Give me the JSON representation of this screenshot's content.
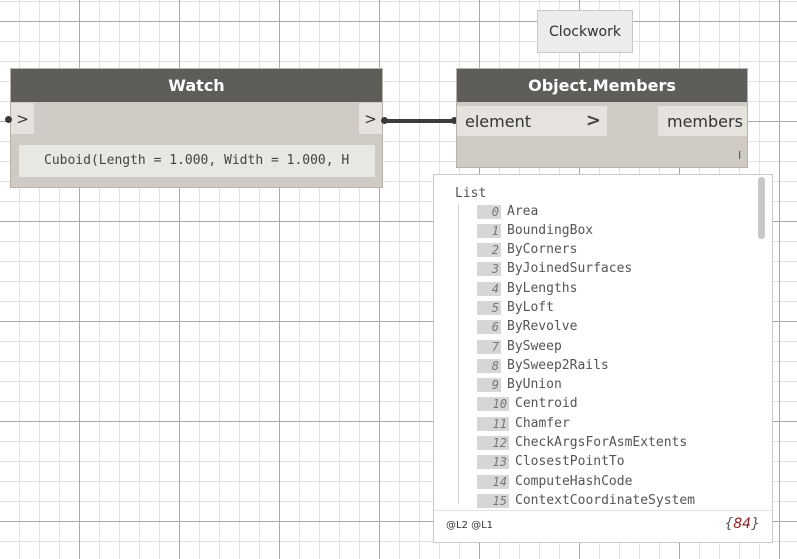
{
  "group_tag": {
    "label": "Clockwork"
  },
  "watch_node": {
    "title": "Watch",
    "input_port": ">",
    "output_port": ">",
    "value": "Cuboid(Length = 1.000, Width = 1.000, H"
  },
  "members_node": {
    "title": "Object.Members",
    "input_port": "element",
    "input_chevron": ">",
    "output_port": "members",
    "lacing": "I"
  },
  "preview": {
    "list_label": "List",
    "items": [
      {
        "index": "0",
        "value": "Area"
      },
      {
        "index": "1",
        "value": "BoundingBox"
      },
      {
        "index": "2",
        "value": "ByCorners"
      },
      {
        "index": "3",
        "value": "ByJoinedSurfaces"
      },
      {
        "index": "4",
        "value": "ByLengths"
      },
      {
        "index": "5",
        "value": "ByLoft"
      },
      {
        "index": "6",
        "value": "ByRevolve"
      },
      {
        "index": "7",
        "value": "BySweep"
      },
      {
        "index": "8",
        "value": "BySweep2Rails"
      },
      {
        "index": "9",
        "value": "ByUnion"
      },
      {
        "index": "10",
        "value": "Centroid"
      },
      {
        "index": "11",
        "value": "Chamfer"
      },
      {
        "index": "12",
        "value": "CheckArgsForAsmExtents"
      },
      {
        "index": "13",
        "value": "ClosestPointTo"
      },
      {
        "index": "14",
        "value": "ComputeHashCode"
      },
      {
        "index": "15",
        "value": "ContextCoordinateSystem"
      }
    ],
    "levels": "@L2 @L1",
    "count": "84",
    "count_open": "{",
    "count_close": "}"
  },
  "colors": {
    "node_header": "#5f5d5a",
    "node_body": "#cfcbc4",
    "port": "#e6e3de",
    "count_text": "#8b1e1e"
  }
}
